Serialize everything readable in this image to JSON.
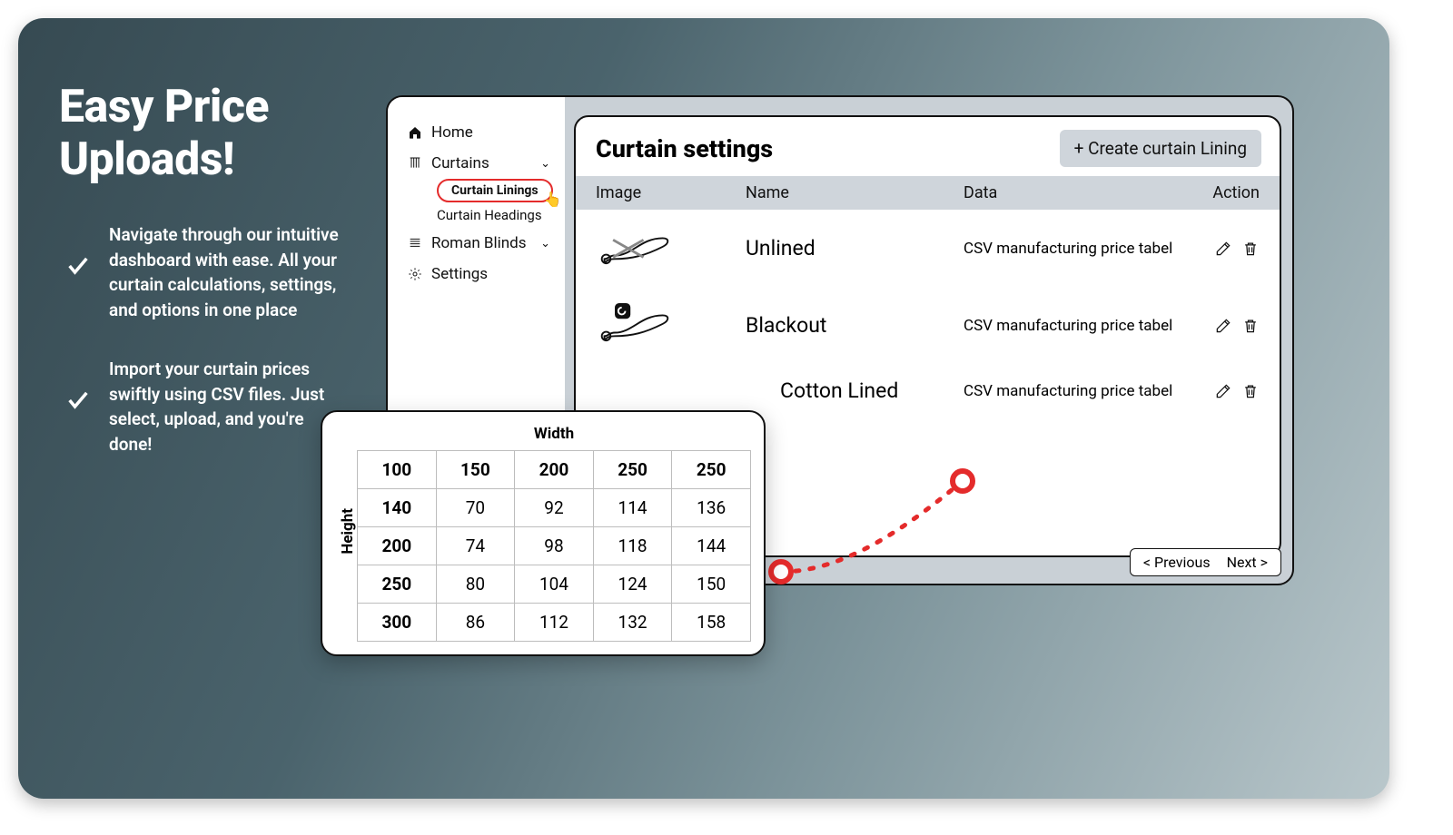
{
  "promo": {
    "headline": "Easy Price Uploads!",
    "bullets": [
      "Navigate through our intuitive dashboard with ease. All your curtain calculations, settings, and options in one place",
      "Import your curtain prices swiftly using CSV files. Just select, upload, and you're done!"
    ]
  },
  "sidebar": {
    "home": "Home",
    "curtains": "Curtains",
    "curtain_linings": "Curtain Linings",
    "curtain_headings": "Curtain Headings",
    "roman_blinds": "Roman Blinds",
    "settings": "Settings"
  },
  "main": {
    "title": "Curtain settings",
    "create_label": "+ Create curtain Lining",
    "columns": {
      "image": "Image",
      "name": "Name",
      "data": "Data",
      "action": "Action"
    },
    "rows": [
      {
        "name": "Unlined",
        "data": "CSV manufacturing price tabel"
      },
      {
        "name": "Blackout",
        "data": "CSV manufacturing price tabel"
      },
      {
        "name": "Cotton Lined",
        "data": "CSV manufacturing price tabel"
      }
    ],
    "prev": "< Previous",
    "next": "Next >"
  },
  "grid": {
    "width_label": "Width",
    "height_label": "Height",
    "rows": [
      [
        "100",
        "150",
        "200",
        "250",
        "250"
      ],
      [
        "140",
        "70",
        "92",
        "114",
        "136"
      ],
      [
        "200",
        "74",
        "98",
        "118",
        "144"
      ],
      [
        "250",
        "80",
        "104",
        "124",
        "150"
      ],
      [
        "300",
        "86",
        "112",
        "132",
        "158"
      ]
    ]
  },
  "chart_data": {
    "type": "table",
    "title": "Curtain price grid",
    "xlabel": "Width",
    "ylabel": "Height",
    "columns": [
      100,
      150,
      200,
      250,
      250
    ],
    "rows": [
      140,
      200,
      250,
      300
    ],
    "values": [
      [
        70,
        92,
        114,
        136
      ],
      [
        74,
        98,
        118,
        144
      ],
      [
        80,
        104,
        124,
        150
      ],
      [
        86,
        112,
        132,
        158
      ]
    ]
  }
}
